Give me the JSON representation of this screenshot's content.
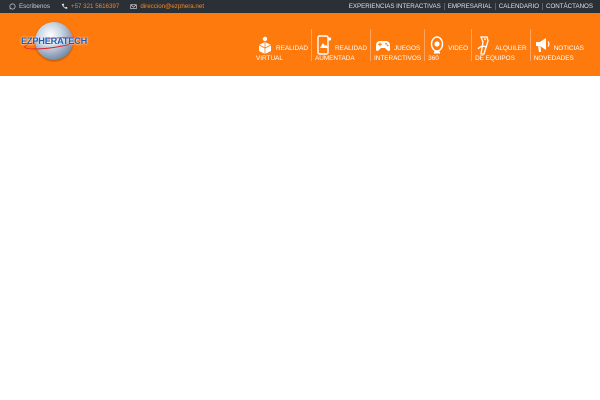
{
  "topbar": {
    "contacts": [
      {
        "label": "Escríbenos",
        "icon": "whatsapp-icon"
      },
      {
        "label": "+57 321 5616397",
        "icon": "phone-icon"
      },
      {
        "label": "direccion@ezphera.net",
        "icon": "mail-icon"
      }
    ],
    "links": [
      "EXPERIENCIAS INTERACTIVAS",
      "EMPRESARIAL",
      "CALENDARIO",
      "CONTÁCTANOS"
    ]
  },
  "header": {
    "logo_text": "EZPHERATECH",
    "nav": [
      {
        "w1": "REALIDAD",
        "w2": "VIRTUAL",
        "icon": "vr-cube-icon"
      },
      {
        "w1": "REALIDAD",
        "w2": "AUMENTADA",
        "icon": "ar-phone-icon"
      },
      {
        "w1": "JUEGOS",
        "w2": "INTERACTIVOS",
        "icon": "gamepad-icon"
      },
      {
        "w1": "VIDEO",
        "w2": "360",
        "icon": "camera-360-icon"
      },
      {
        "w1": "ALQUILER",
        "w2": "DE EQUIPOS",
        "icon": "vr-controller-icon"
      },
      {
        "w1": "NOTICIAS",
        "w2": "NOVEDADES",
        "icon": "megaphone-icon"
      }
    ]
  },
  "colors": {
    "topbar_bg": "#2b2f36",
    "header_bg": "#ff7a0d",
    "accent": "#f28a22"
  }
}
